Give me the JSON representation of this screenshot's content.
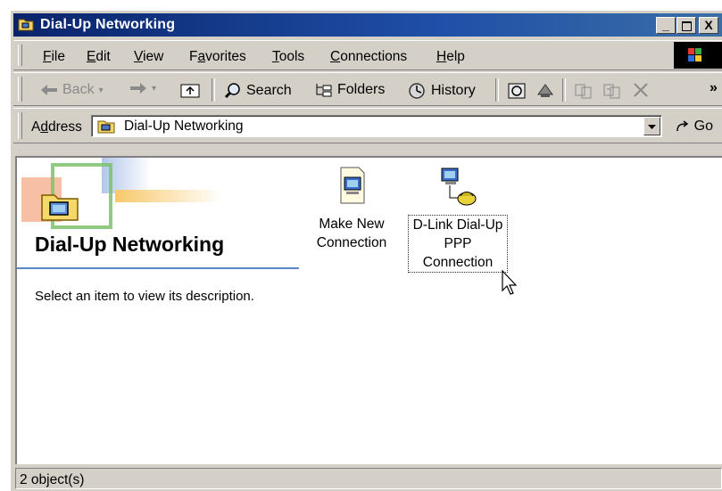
{
  "window": {
    "title": "Dial-Up Networking"
  },
  "caption_buttons": {
    "minimize": "_",
    "maximize": "□",
    "close": "X"
  },
  "menu": {
    "items": [
      {
        "label": "File",
        "accel": "F",
        "rest": "ile"
      },
      {
        "label": "Edit",
        "accel": "E",
        "rest": "dit"
      },
      {
        "label": "View",
        "accel": "V",
        "rest": "iew"
      },
      {
        "label": "Favorites",
        "pre": "F",
        "accel": "a",
        "rest": "vorites"
      },
      {
        "label": "Tools",
        "accel": "T",
        "rest": "ools"
      },
      {
        "label": "Connections",
        "accel": "C",
        "rest": "onnections"
      },
      {
        "label": "Help",
        "accel": "H",
        "rest": "elp"
      }
    ]
  },
  "toolbar": {
    "back": "Back",
    "search": "Search",
    "folders": "Folders",
    "history": "History",
    "chevron": "»"
  },
  "address": {
    "label_pre": "A",
    "label_accel": "d",
    "label_rest": "dress",
    "value": "Dial-Up Networking",
    "go": "Go"
  },
  "panel": {
    "title": "Dial-Up Networking",
    "description": "Select an item to view its description."
  },
  "items": [
    {
      "line1": "Make New",
      "line2": "Connection"
    },
    {
      "line1": "D-Link Dial-Up",
      "line2": "PPP",
      "line3": "Connection"
    }
  ],
  "status": {
    "text": "2 object(s)"
  }
}
